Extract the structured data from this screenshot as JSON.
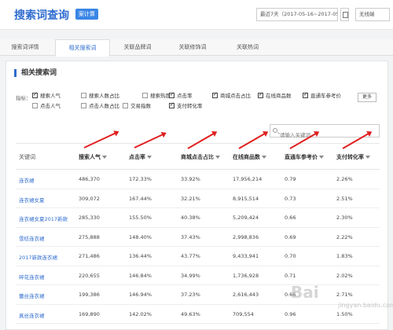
{
  "header": {
    "title": "搜索词查询",
    "badge": "案计算",
    "date_range": "最近7天（2017-05-16~2017-05-22）",
    "terminal": "无线端"
  },
  "tabs": [
    "搜索词详情",
    "相关搜索词",
    "关联品牌词",
    "关联修饰词",
    "关联热词"
  ],
  "active_tab": 1,
  "section_title": "相关搜索词",
  "metrics": {
    "label": "指标：",
    "options": [
      {
        "label": "搜索人气",
        "checked": true
      },
      {
        "label": "搜索人数占比",
        "checked": false
      },
      {
        "label": "搜索热度",
        "checked": false
      },
      {
        "label": "点击率",
        "checked": true
      },
      {
        "label": "商城点击占比",
        "checked": true
      },
      {
        "label": "在线商品数",
        "checked": true
      },
      {
        "label": "直通车参考价",
        "checked": true
      },
      {
        "label": "点击人气",
        "checked": false
      },
      {
        "label": "点击人数占比",
        "checked": false
      },
      {
        "label": "交易指数",
        "checked": false
      },
      {
        "label": "支付转化率",
        "checked": true
      }
    ],
    "more": "更多"
  },
  "search": {
    "placeholder": "请输入关键词"
  },
  "table": {
    "headers": [
      "关键词",
      "搜索人气",
      "点击率",
      "商城点击占比",
      "在线商品数",
      "直通车参考价",
      "支付转化率"
    ],
    "rows": [
      [
        "连衣裙",
        "486,370",
        "172.33%",
        "33.92%",
        "17,956,214",
        "0.79",
        "2.26%"
      ],
      [
        "连衣裙女夏",
        "309,072",
        "167.44%",
        "32.21%",
        "8,915,514",
        "0.73",
        "2.51%"
      ],
      [
        "连衣裙女夏2017新款",
        "285,330",
        "155.50%",
        "40.38%",
        "5,209,424",
        "0.66",
        "2.30%"
      ],
      [
        "雪纺连衣裙",
        "275,888",
        "148.40%",
        "37.43%",
        "2,998,836",
        "0.69",
        "2.22%"
      ],
      [
        "2017新款连衣裙",
        "271,486",
        "136.44%",
        "43.77%",
        "9,433,941",
        "0.70",
        "1.83%"
      ],
      [
        "碎花连衣裙",
        "220,655",
        "146.84%",
        "34.99%",
        "1,736,928",
        "0.71",
        "2.02%"
      ],
      [
        "蕾丝连衣裙",
        "199,386",
        "146.94%",
        "37.23%",
        "2,616,443",
        "0.66",
        "2.71%"
      ],
      [
        "真丝连衣裙",
        "169,890",
        "142.02%",
        "49.63%",
        "709,554",
        "0.96",
        "1.50%"
      ]
    ]
  },
  "watermark": {
    "main": "Bai",
    "sub": "jingyan.baidu.com"
  }
}
